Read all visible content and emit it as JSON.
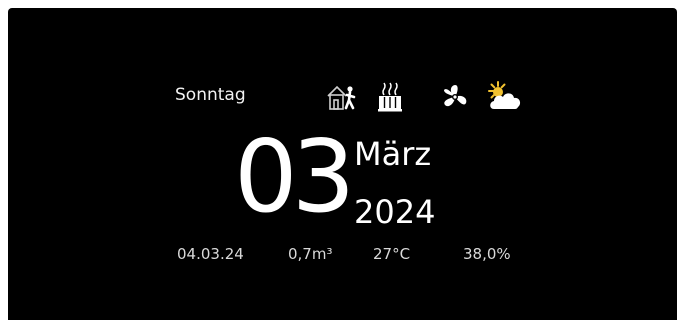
{
  "weekday": "Sonntag",
  "status_icons": [
    "away-from-home-icon",
    "heater-icon",
    "fan-icon",
    "partly-cloudy-icon"
  ],
  "date": {
    "day": "03",
    "month": "März",
    "year": "2024"
  },
  "readouts": {
    "date_short": "04.03.24",
    "volume": "0,7m³",
    "temperature": "27°C",
    "humidity": "38,0%"
  },
  "colors": {
    "background": "#000000",
    "text": "#ffffff",
    "sun": "#f2c230"
  }
}
